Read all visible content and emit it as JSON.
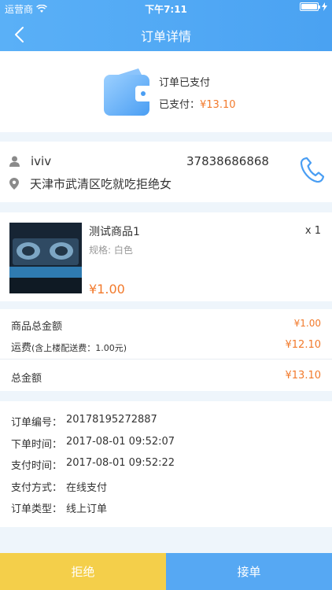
{
  "status_bar": {
    "carrier": "运营商",
    "time": "下午7:11"
  },
  "nav": {
    "title": "订单详情"
  },
  "order_status": {
    "text": "订单已支付",
    "paid_label": "已支付：",
    "paid_amount": "¥13.10"
  },
  "contact": {
    "name": "iviv",
    "phone": "37838686868",
    "address": "天津市武清区吃就吃拒绝女"
  },
  "goods": {
    "name": "测试商品1",
    "quantity": "x 1",
    "spec": "规格: 白色",
    "price": "¥1.00"
  },
  "summary": {
    "goods_total_label": "商品总金额",
    "goods_total_value": "¥1.00",
    "shipping_label": "运费",
    "shipping_note": "(含上楼配送费：1.00元)",
    "shipping_value": "¥12.10",
    "total_label": "总金额",
    "total_value": "¥13.10"
  },
  "order_info": [
    {
      "label": "订单编号：",
      "value": "20178195272887"
    },
    {
      "label": "下单时间：",
      "value": "2017-08-01 09:52:07"
    },
    {
      "label": "支付时间：",
      "value": "2017-08-01 09:52:22"
    },
    {
      "label": "支付方式：",
      "value": "在线支付"
    },
    {
      "label": "订单类型：",
      "value": "线上订单"
    }
  ],
  "actions": {
    "reject": "拒绝",
    "accept": "接单"
  },
  "colors": {
    "primary": "#4aa2f2",
    "price": "#f27a2c",
    "reject": "#f4cf4a",
    "accept": "#56a8f3"
  }
}
